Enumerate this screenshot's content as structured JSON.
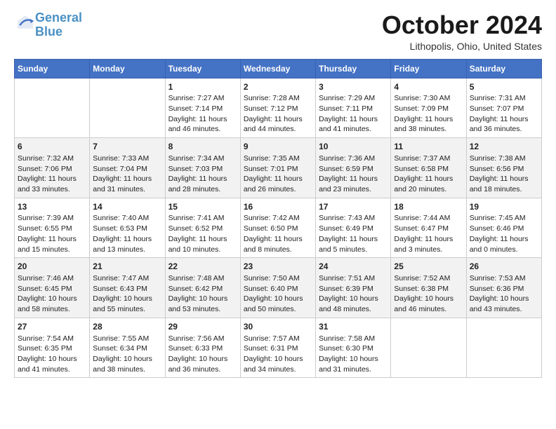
{
  "header": {
    "logo_line1": "General",
    "logo_line2": "Blue",
    "month": "October 2024",
    "location": "Lithopolis, Ohio, United States"
  },
  "weekdays": [
    "Sunday",
    "Monday",
    "Tuesday",
    "Wednesday",
    "Thursday",
    "Friday",
    "Saturday"
  ],
  "weeks": [
    [
      {
        "day": "",
        "detail": ""
      },
      {
        "day": "",
        "detail": ""
      },
      {
        "day": "1",
        "detail": "Sunrise: 7:27 AM\nSunset: 7:14 PM\nDaylight: 11 hours\nand 46 minutes."
      },
      {
        "day": "2",
        "detail": "Sunrise: 7:28 AM\nSunset: 7:12 PM\nDaylight: 11 hours\nand 44 minutes."
      },
      {
        "day": "3",
        "detail": "Sunrise: 7:29 AM\nSunset: 7:11 PM\nDaylight: 11 hours\nand 41 minutes."
      },
      {
        "day": "4",
        "detail": "Sunrise: 7:30 AM\nSunset: 7:09 PM\nDaylight: 11 hours\nand 38 minutes."
      },
      {
        "day": "5",
        "detail": "Sunrise: 7:31 AM\nSunset: 7:07 PM\nDaylight: 11 hours\nand 36 minutes."
      }
    ],
    [
      {
        "day": "6",
        "detail": "Sunrise: 7:32 AM\nSunset: 7:06 PM\nDaylight: 11 hours\nand 33 minutes."
      },
      {
        "day": "7",
        "detail": "Sunrise: 7:33 AM\nSunset: 7:04 PM\nDaylight: 11 hours\nand 31 minutes."
      },
      {
        "day": "8",
        "detail": "Sunrise: 7:34 AM\nSunset: 7:03 PM\nDaylight: 11 hours\nand 28 minutes."
      },
      {
        "day": "9",
        "detail": "Sunrise: 7:35 AM\nSunset: 7:01 PM\nDaylight: 11 hours\nand 26 minutes."
      },
      {
        "day": "10",
        "detail": "Sunrise: 7:36 AM\nSunset: 6:59 PM\nDaylight: 11 hours\nand 23 minutes."
      },
      {
        "day": "11",
        "detail": "Sunrise: 7:37 AM\nSunset: 6:58 PM\nDaylight: 11 hours\nand 20 minutes."
      },
      {
        "day": "12",
        "detail": "Sunrise: 7:38 AM\nSunset: 6:56 PM\nDaylight: 11 hours\nand 18 minutes."
      }
    ],
    [
      {
        "day": "13",
        "detail": "Sunrise: 7:39 AM\nSunset: 6:55 PM\nDaylight: 11 hours\nand 15 minutes."
      },
      {
        "day": "14",
        "detail": "Sunrise: 7:40 AM\nSunset: 6:53 PM\nDaylight: 11 hours\nand 13 minutes."
      },
      {
        "day": "15",
        "detail": "Sunrise: 7:41 AM\nSunset: 6:52 PM\nDaylight: 11 hours\nand 10 minutes."
      },
      {
        "day": "16",
        "detail": "Sunrise: 7:42 AM\nSunset: 6:50 PM\nDaylight: 11 hours\nand 8 minutes."
      },
      {
        "day": "17",
        "detail": "Sunrise: 7:43 AM\nSunset: 6:49 PM\nDaylight: 11 hours\nand 5 minutes."
      },
      {
        "day": "18",
        "detail": "Sunrise: 7:44 AM\nSunset: 6:47 PM\nDaylight: 11 hours\nand 3 minutes."
      },
      {
        "day": "19",
        "detail": "Sunrise: 7:45 AM\nSunset: 6:46 PM\nDaylight: 11 hours\nand 0 minutes."
      }
    ],
    [
      {
        "day": "20",
        "detail": "Sunrise: 7:46 AM\nSunset: 6:45 PM\nDaylight: 10 hours\nand 58 minutes."
      },
      {
        "day": "21",
        "detail": "Sunrise: 7:47 AM\nSunset: 6:43 PM\nDaylight: 10 hours\nand 55 minutes."
      },
      {
        "day": "22",
        "detail": "Sunrise: 7:48 AM\nSunset: 6:42 PM\nDaylight: 10 hours\nand 53 minutes."
      },
      {
        "day": "23",
        "detail": "Sunrise: 7:50 AM\nSunset: 6:40 PM\nDaylight: 10 hours\nand 50 minutes."
      },
      {
        "day": "24",
        "detail": "Sunrise: 7:51 AM\nSunset: 6:39 PM\nDaylight: 10 hours\nand 48 minutes."
      },
      {
        "day": "25",
        "detail": "Sunrise: 7:52 AM\nSunset: 6:38 PM\nDaylight: 10 hours\nand 46 minutes."
      },
      {
        "day": "26",
        "detail": "Sunrise: 7:53 AM\nSunset: 6:36 PM\nDaylight: 10 hours\nand 43 minutes."
      }
    ],
    [
      {
        "day": "27",
        "detail": "Sunrise: 7:54 AM\nSunset: 6:35 PM\nDaylight: 10 hours\nand 41 minutes."
      },
      {
        "day": "28",
        "detail": "Sunrise: 7:55 AM\nSunset: 6:34 PM\nDaylight: 10 hours\nand 38 minutes."
      },
      {
        "day": "29",
        "detail": "Sunrise: 7:56 AM\nSunset: 6:33 PM\nDaylight: 10 hours\nand 36 minutes."
      },
      {
        "day": "30",
        "detail": "Sunrise: 7:57 AM\nSunset: 6:31 PM\nDaylight: 10 hours\nand 34 minutes."
      },
      {
        "day": "31",
        "detail": "Sunrise: 7:58 AM\nSunset: 6:30 PM\nDaylight: 10 hours\nand 31 minutes."
      },
      {
        "day": "",
        "detail": ""
      },
      {
        "day": "",
        "detail": ""
      }
    ]
  ]
}
